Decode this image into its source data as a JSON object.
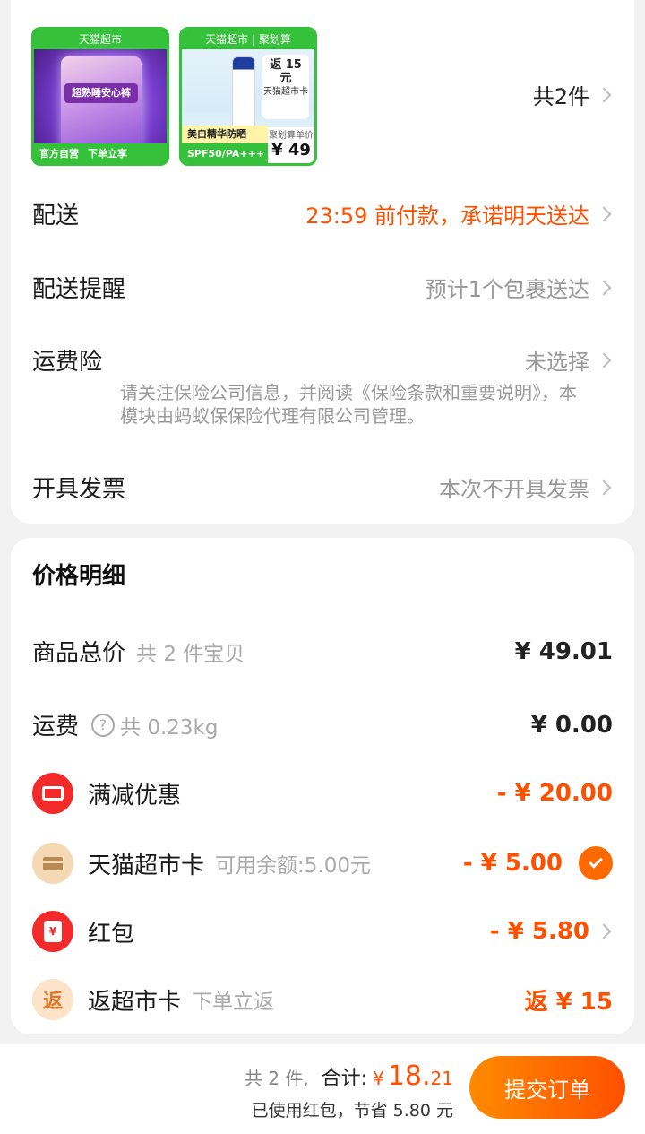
{
  "products": {
    "item1": {
      "store_tag": "天猫超市",
      "badge_left": "官方自营",
      "badge_right": "下单立享",
      "pack_label": "超熟睡安心裤"
    },
    "item2": {
      "store_tag": "天猫超市 | 聚划算",
      "name": "美白精华防晒",
      "spec": "SPF50/PA+++",
      "promo_line1": "返 15 元",
      "promo_line2": "天猫超市卡",
      "price_label": "聚划算单价",
      "price": "¥ 49"
    },
    "count_label": "共2件"
  },
  "order_rows": {
    "delivery": {
      "label": "配送",
      "value": "23:59 前付款，承诺明天送达"
    },
    "delivery_reminder": {
      "label": "配送提醒",
      "value": "预计1个包裹送达"
    },
    "shipping_insurance": {
      "label": "运费险",
      "value": "未选择",
      "note": "请关注保险公司信息，并阅读《保险条款和重要说明》，本模块由蚂蚁保保险代理有限公司管理。"
    },
    "invoice": {
      "label": "开具发票",
      "value": "本次不开具发票"
    }
  },
  "price_detail": {
    "title": "价格明细",
    "goods_total": {
      "label": "商品总价",
      "sub": "共 2 件宝贝",
      "amount": "¥ 49.01"
    },
    "shipping_fee": {
      "label": "运费",
      "sub": "共 0.23kg",
      "amount": "¥ 0.00"
    },
    "discount": {
      "label": "满减优惠",
      "amount": "- ¥ 20.00"
    },
    "tmall_card": {
      "label": "天猫超市卡",
      "sub": "可用余额:5.00元",
      "amount": "- ¥ 5.00"
    },
    "red_packet": {
      "label": "红包",
      "amount": "- ¥ 5.80"
    },
    "cashback": {
      "label": "返超市卡",
      "sub": "下单立返",
      "amount": "返 ¥ 15",
      "icon_text": "返"
    }
  },
  "bottom_bar": {
    "count": "共 2 件,",
    "total_label": "合计:",
    "currency": "¥",
    "total_int": "18.",
    "total_dec": "21",
    "savings": "已使用红包，节省 5.80 元",
    "submit_label": "提交订单"
  },
  "colors": {
    "accent": "#ff5000",
    "store_green": "#35c23a"
  }
}
